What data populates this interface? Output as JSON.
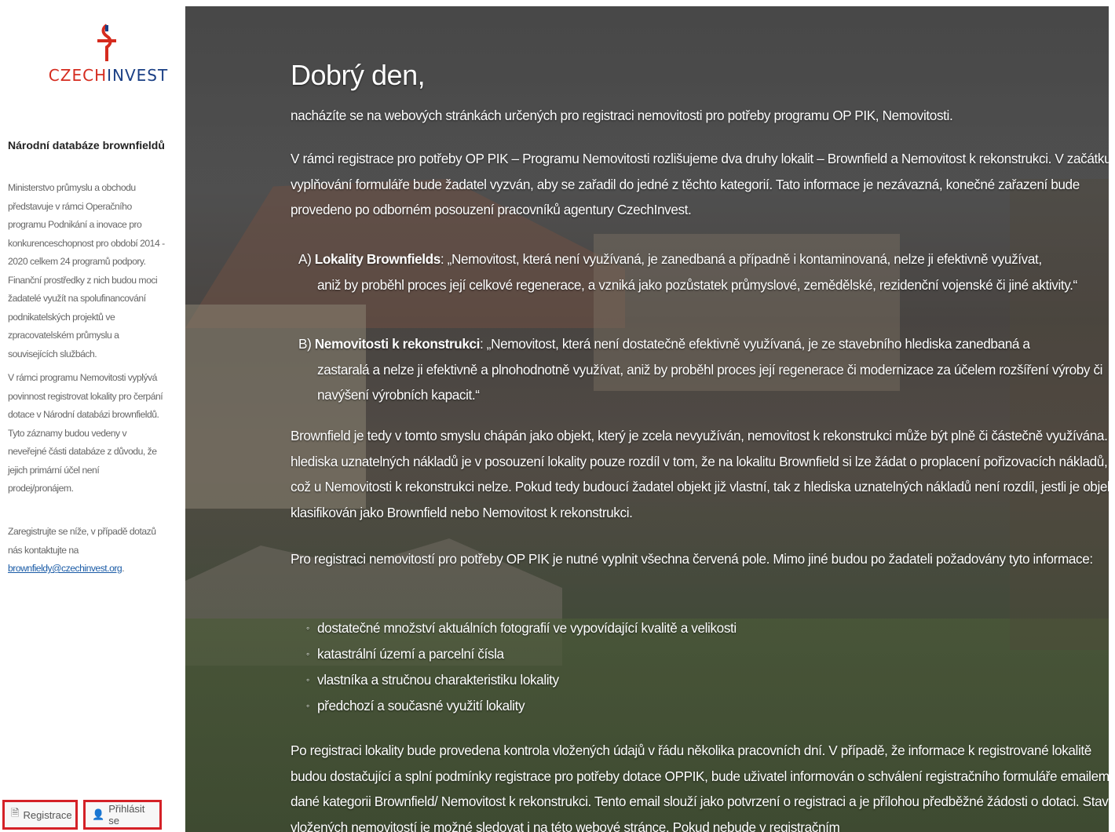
{
  "sidebar": {
    "logo_text_red": "CZECH",
    "logo_text_blue": "INVEST",
    "title": "Národní databáze brownfieldů",
    "p1": "Ministerstvo průmyslu a obchodu představuje v rámci Operačního programu Podnikání a inovace pro konkurenceschopnost pro období 2014 - 2020 celkem 24 programů podpory. Finanční prostředky z nich budou moci žadatelé využít na spolufinancování podnikatelských projektů ve zpracovatelském průmyslu a souvisejících službách.",
    "p2": "V rámci programu Nemovitosti vyplývá povinnost registrovat lokality pro čerpání dotace v Národní databázi brownfieldů. Tyto záznamy budou vedeny v neveřejné části databáze z důvodu, že jejich primární účel není prodej/pronájem.",
    "p3_text": "Zaregistrujte se níže, v případě dotazů nás kontaktujte na",
    "p3_link": "brownfieldy@czechinvest.org",
    "p3_end": ".",
    "btn_register": "Registrace",
    "btn_login": "Přihlásit se"
  },
  "main": {
    "greeting": "Dobrý den,",
    "intro": "nacházíte se na webových stránkách určených pro registraci nemovitosti pro potřeby programu OP PIK, Nemovitosti.",
    "p2": "V rámci registrace pro potřeby OP PIK – Programu Nemovitosti rozlišujeme dva druhy lokalit – Brownfield a Nemovitost k rekonstrukci. V začátku vyplňování formuláře bude žadatel vyzván, aby se zařadil do jedné z těchto kategorií. Tato informace je nezávazná, konečné zařazení bude provedeno po odborném posouzení pracovníků agentury CzechInvest.",
    "item_a_prefix": "A)",
    "item_a_label": "Lokality Brownfields",
    "item_a_line1": ": „Nemovitost, která není využívaná, je zanedbaná a případně i kontaminovaná, nelze ji efektivně využívat,",
    "item_a_cont": "aniž by proběhl proces její celkové regenerace, a vzniká jako pozůstatek průmyslové, zemědělské, rezidenční vojenské či jiné aktivity.“",
    "item_b_prefix": "B)",
    "item_b_label": "Nemovitosti k rekonstrukci",
    "item_b_line1": ": „Nemovitost, která není dostatečně efektivně využívaná, je ze stavebního hlediska zanedbaná a",
    "item_b_cont": "zastaralá a nelze ji efektivně a plnohodnotně využívat, aniž by proběhl proces její regenerace či modernizace za účelem rozšíření výroby či navýšení výrobních kapacit.“",
    "p3": "Brownfield je tedy v tomto smyslu chápán jako objekt, který je zcela nevyužíván, nemovitost k rekonstrukci může být plně či částečně využívána. Z hlediska uznatelných nákladů je v posouzení lokality pouze rozdíl v tom, že na lokalitu Brownfield si lze žádat o proplacení pořizovacích nákladů, což u Nemovitosti k rekonstrukci nelze. Pokud tedy budoucí žadatel objekt již vlastní, tak z hlediska uznatelných nákladů není rozdíl, jestli je objekt klasifikován jako Brownfield nebo Nemovitost k rekonstrukci.",
    "p4": "Pro registraci nemovitostí pro potřeby OP PIK je nutné vyplnit všechna červená pole. Mimo jiné budou po žadateli požadovány tyto informace:",
    "list": [
      "dostatečné množství aktuálních fotografií ve vypovídající kvalitě a velikosti",
      "katastrální území a parcelní čísla",
      "vlastníka a stručnou charakteristiku lokality",
      "předchozí a současné využití lokality"
    ],
    "p5": "Po registraci lokality bude provedena kontrola vložených údajů v řádu několika pracovních dní. V případě, že informace k registrované lokalitě budou dostačující a splní podmínky registrace pro potřeby dotace OPPIK, bude uživatel informován o schválení registračního formuláře emailem v dané kategorii Brownfield/ Nemovitost k rekonstrukci. Tento email slouží jako potvrzení o registraci a je přílohou předběžné žádosti o dotaci. Stav vložených nemovitostí je možné sledovat i na této webové stránce. Pokud nebude v registračním"
  },
  "colors": {
    "brand_red": "#d52b1e",
    "brand_blue": "#1a3f85",
    "button_border": "#d42127",
    "link": "#1a5ba6"
  },
  "icons": {
    "register": "document-icon",
    "login": "user-icon",
    "logo": "czechinvest-logo-icon"
  }
}
